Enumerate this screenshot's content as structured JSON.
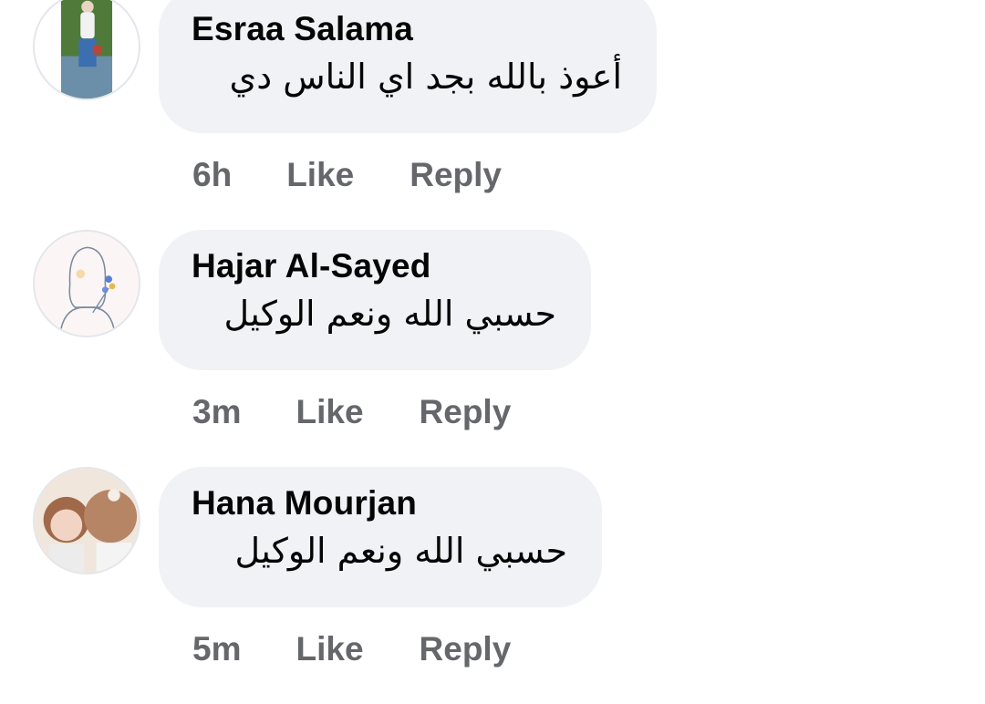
{
  "comments": [
    {
      "author": "Esraa Salama",
      "text": "أعوذ بالله بجد اي الناس دي",
      "time": "6h",
      "like_label": "Like",
      "reply_label": "Reply",
      "avatar_icon": "profile-photo-icon"
    },
    {
      "author": "Hajar Al-Sayed",
      "text": "حسبي الله ونعم الوكيل",
      "time": "3m",
      "like_label": "Like",
      "reply_label": "Reply",
      "avatar_icon": "profile-illustration-icon"
    },
    {
      "author": "Hana Mourjan",
      "text": "حسبي الله ونعم الوكيل",
      "time": "5m",
      "like_label": "Like",
      "reply_label": "Reply",
      "avatar_icon": "profile-photo-icon"
    }
  ],
  "colors": {
    "bubble": "#f0f2f5",
    "author": "#050505",
    "actions": "#65676b"
  }
}
